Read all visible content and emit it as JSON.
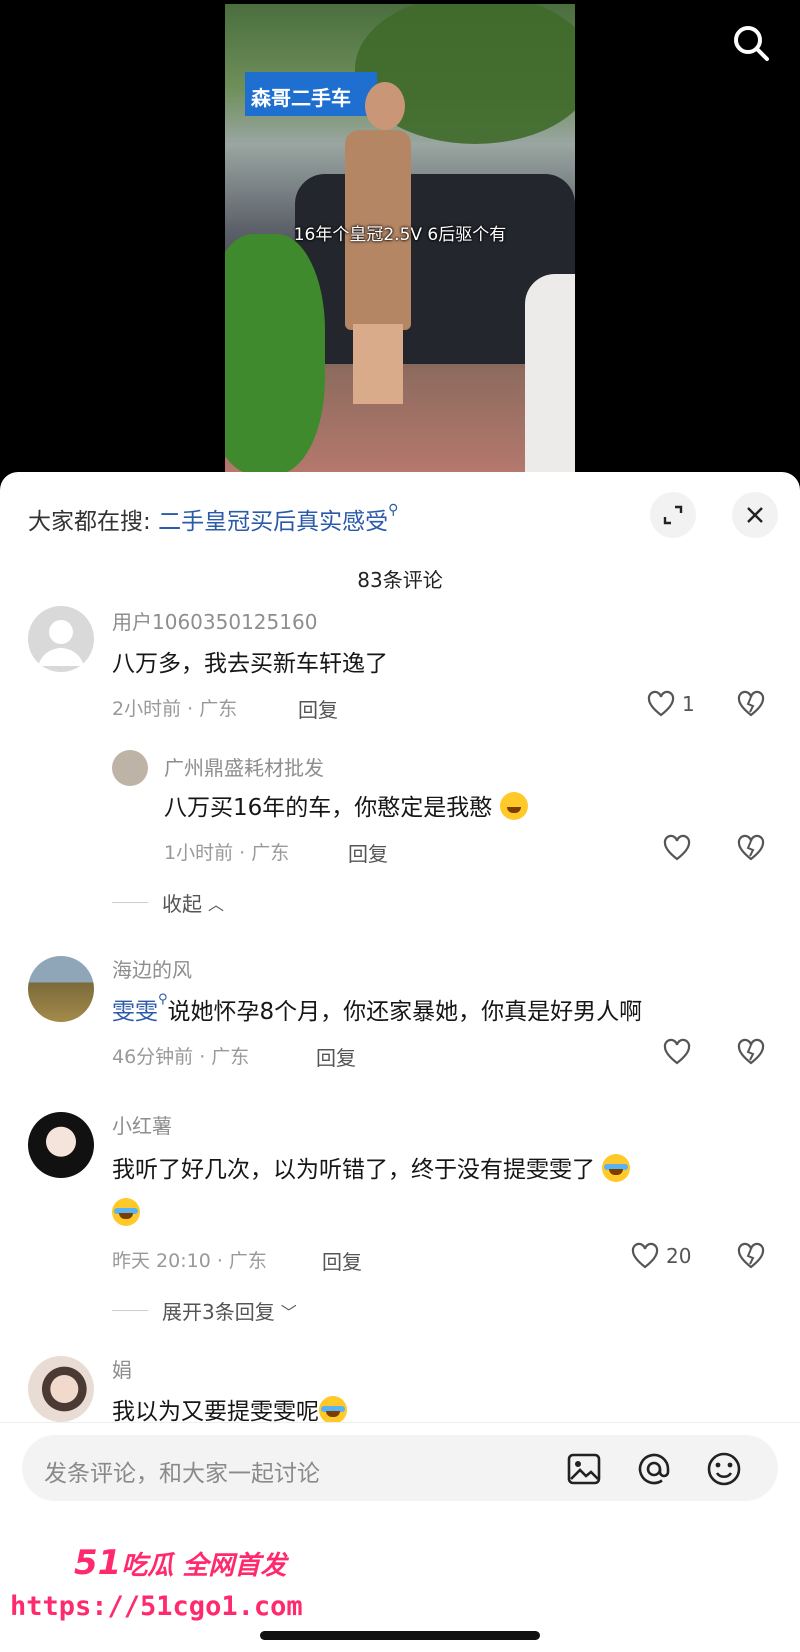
{
  "video": {
    "sign_text": "森哥二手车",
    "caption": "16年个皇冠2.5V 6后驱个有",
    "search_icon": "search-icon"
  },
  "panel": {
    "search_prefix": "大家都在搜:",
    "search_link": "二手皇冠买后真实感受",
    "expand_icon": "expand-icon",
    "close_icon": "close-icon",
    "comment_count": "83条评论"
  },
  "comments": [
    {
      "name": "用户1060350125160",
      "text": "八万多，我去买新车轩逸了",
      "time": "2小时前 · 广东",
      "reply_label": "回复",
      "likes": "1",
      "replies": [
        {
          "name": "广州鼎盛耗材批发",
          "text": "八万买16年的车，你憨定是我憨",
          "time": "1小时前 · 广东",
          "reply_label": "回复"
        }
      ],
      "collapse_label": "收起"
    },
    {
      "name": "海边的风",
      "tag": "雯雯",
      "text": "说她怀孕8个月，你还家暴她，你真是好男人啊",
      "time": "46分钟前 · 广东",
      "reply_label": "回复"
    },
    {
      "name": "小红薯",
      "text": "我听了好几次，以为听错了，终于没有提雯雯了",
      "time": "昨天 20:10 · 广东",
      "reply_label": "回复",
      "likes": "20",
      "expand_label": "展开3条回复"
    },
    {
      "name": "娟",
      "text": "我以为又要提雯雯呢"
    }
  ],
  "input": {
    "placeholder": "发条评论，和大家一起讨论",
    "image_icon": "image-icon",
    "at_icon": "at-icon",
    "emoji_icon": "emoji-icon"
  },
  "watermark": {
    "brand_num": "51",
    "brand_text": "吃瓜 全网首发",
    "url": "https://51cgo1.com"
  }
}
